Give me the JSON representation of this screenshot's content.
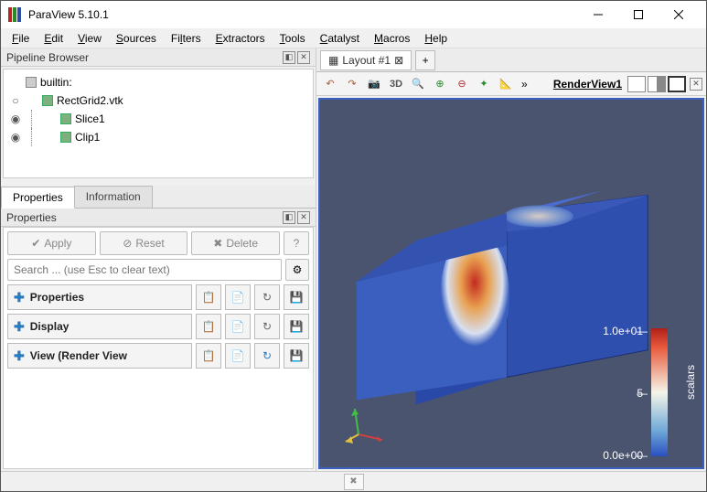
{
  "window": {
    "title": "ParaView 5.10.1"
  },
  "menu": [
    "File",
    "Edit",
    "View",
    "Sources",
    "Filters",
    "Extractors",
    "Tools",
    "Catalyst",
    "Macros",
    "Help"
  ],
  "pipeline": {
    "title": "Pipeline Browser",
    "items": [
      {
        "label": "builtin:",
        "icon": "server",
        "eye": "",
        "indent": 0
      },
      {
        "label": "RectGrid2.vtk",
        "icon": "cube",
        "eye": "○",
        "indent": 1
      },
      {
        "label": "Slice1",
        "icon": "cube",
        "eye": "◉",
        "indent": 2
      },
      {
        "label": "Clip1",
        "icon": "cube",
        "eye": "◉",
        "indent": 2
      }
    ]
  },
  "tabs": {
    "properties": "Properties",
    "information": "Information"
  },
  "properties": {
    "header": "Properties",
    "apply": "Apply",
    "reset": "Reset",
    "delete": "Delete",
    "search_placeholder": "Search ... (use Esc to clear text)",
    "sections": [
      "Properties",
      "Display",
      "View (Render View"
    ]
  },
  "layout": {
    "tab": "Layout #1",
    "toolbar3d": "3D",
    "renderlabel": "RenderView1"
  },
  "colorbar": {
    "title": "scalars",
    "max": "1.0e+01",
    "mid": "5",
    "min": "0.0e+00"
  }
}
